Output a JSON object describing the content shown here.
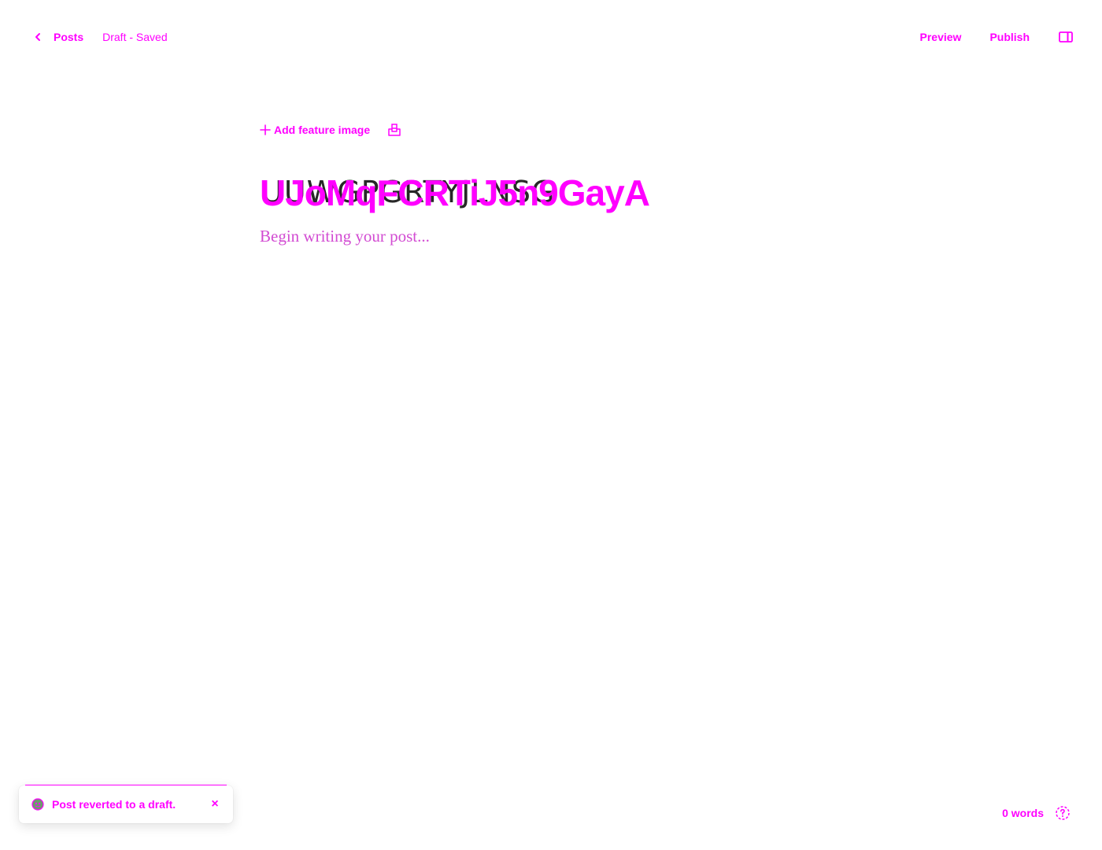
{
  "header": {
    "back_label": "Posts",
    "status": "Draft - Saved",
    "preview_label": "Preview",
    "publish_label": "Publish"
  },
  "editor": {
    "add_feature_label": "Add feature image",
    "title_value": "UJoMqFCRTiJ5n9GayA",
    "title_ghost": "UUWGPGRTYJLNSG",
    "body_placeholder": "Begin writing your post..."
  },
  "toast": {
    "message": "Post reverted to a draft.",
    "close_glyph": "×"
  },
  "footer": {
    "word_count": "0 words"
  },
  "colors": {
    "accent": "#ff00ff",
    "text_dark": "#111111",
    "background": "#ffffff"
  },
  "icons": {
    "back": "chevron-left-icon",
    "sidebar": "sidebar-panel-icon",
    "add": "plus-icon",
    "unsplash": "unsplash-icon",
    "toast": "globe-status-icon",
    "close": "close-icon",
    "help": "help-circle-icon"
  }
}
